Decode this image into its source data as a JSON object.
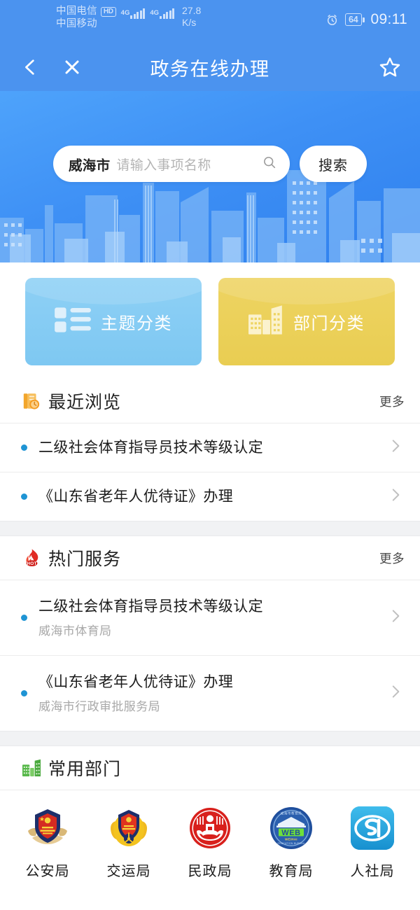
{
  "status_bar": {
    "carrier_primary": "中国电信",
    "carrier_secondary": "中国移动",
    "hd_badge": "HD",
    "network_type_1": "4G",
    "network_type_2": "4G",
    "net_speed_value": "27.8",
    "net_speed_unit": "K/s",
    "battery_percent": "64",
    "time": "09:11",
    "alarm_icon": "alarm-clock-icon"
  },
  "titlebar": {
    "title": "政务在线办理",
    "back_icon": "chevron-left-icon",
    "close_icon": "close-icon",
    "favorite_icon": "star-outline-icon"
  },
  "hero": {
    "search": {
      "city": "威海市",
      "placeholder": "请输入事项名称",
      "value": "",
      "search_icon": "search-icon",
      "button_label": "搜索"
    }
  },
  "cards": [
    {
      "label": "主题分类",
      "icon": "list-grid-icon",
      "color": "#8ed0f5"
    },
    {
      "label": "部门分类",
      "icon": "buildings-icon",
      "color": "#eed462"
    }
  ],
  "sections": [
    {
      "key": "recent",
      "title": "最近浏览",
      "icon": "book-clock-icon",
      "more_label": "更多",
      "items": [
        {
          "title": "二级社会体育指导员技术等级认定",
          "sub": ""
        },
        {
          "title": "《山东省老年人优待证》办理",
          "sub": ""
        }
      ]
    },
    {
      "key": "hot",
      "title": "热门服务",
      "icon": "hot-flame-icon",
      "more_label": "更多",
      "items": [
        {
          "title": "二级社会体育指导员技术等级认定",
          "sub": "威海市体育局"
        },
        {
          "title": "《山东省老年人优待证》办理",
          "sub": "威海市行政审批服务局"
        }
      ]
    },
    {
      "key": "departments",
      "title": "常用部门",
      "icon": "green-buildings-icon",
      "more_label": ""
    }
  ],
  "departments": [
    {
      "name": "公安局",
      "icon": "police-emblem-icon"
    },
    {
      "name": "交运局",
      "icon": "transport-emblem-icon"
    },
    {
      "name": "民政局",
      "icon": "civil-affairs-emblem-icon"
    },
    {
      "name": "教育局",
      "icon": "education-web-emblem-icon"
    },
    {
      "name": "人社局",
      "icon": "social-security-si-icon"
    }
  ],
  "colors": {
    "header_blue": "#4b93ef",
    "hero_blue": "#3e90f5",
    "accent_dot": "#1f94d4",
    "card_blue": "#8ed0f5",
    "card_yellow": "#eed462"
  }
}
